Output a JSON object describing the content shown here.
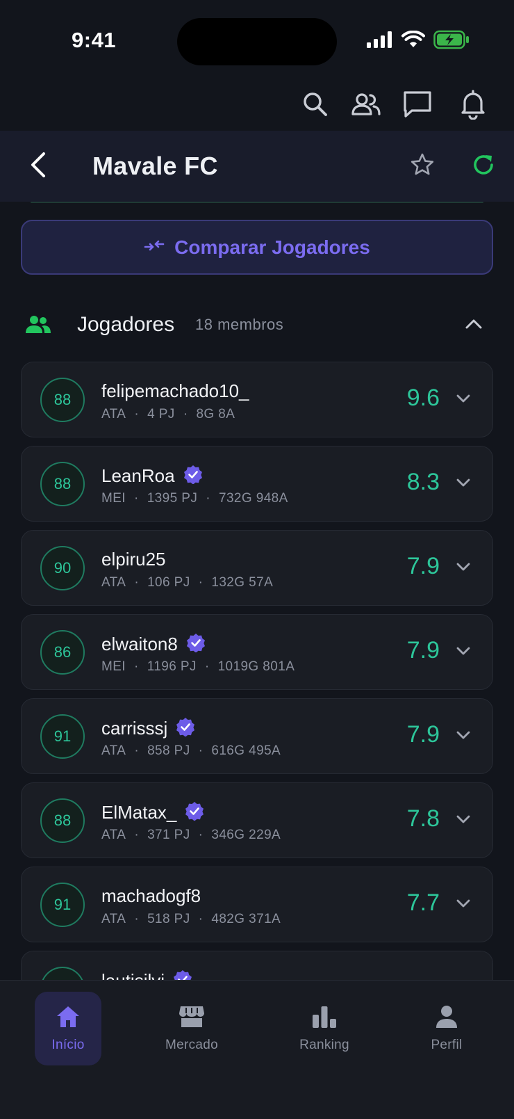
{
  "status_bar": {
    "time": "9:41"
  },
  "header": {
    "title": "Mavale FC"
  },
  "compare_button": {
    "label": "Comparar Jogadores"
  },
  "section": {
    "title": "Jogadores",
    "count": "18 membros"
  },
  "players": [
    {
      "ovr": "88",
      "name": "felipemachado10_",
      "verified": false,
      "position": "ATA",
      "games": "4 PJ",
      "goals_assists": "8G 8A",
      "rating": "9.6"
    },
    {
      "ovr": "88",
      "name": "LeanRoa",
      "verified": true,
      "position": "MEI",
      "games": "1395 PJ",
      "goals_assists": "732G 948A",
      "rating": "8.3"
    },
    {
      "ovr": "90",
      "name": "elpiru25",
      "verified": false,
      "position": "ATA",
      "games": "106 PJ",
      "goals_assists": "132G 57A",
      "rating": "7.9"
    },
    {
      "ovr": "86",
      "name": "elwaiton8",
      "verified": true,
      "position": "MEI",
      "games": "1196 PJ",
      "goals_assists": "1019G 801A",
      "rating": "7.9"
    },
    {
      "ovr": "91",
      "name": "carrisssj",
      "verified": true,
      "position": "ATA",
      "games": "858 PJ",
      "goals_assists": "616G 495A",
      "rating": "7.9"
    },
    {
      "ovr": "88",
      "name": "ElMatax_",
      "verified": true,
      "position": "ATA",
      "games": "371 PJ",
      "goals_assists": "346G 229A",
      "rating": "7.8"
    },
    {
      "ovr": "91",
      "name": "machadogf8",
      "verified": false,
      "position": "ATA",
      "games": "518 PJ",
      "goals_assists": "482G 371A",
      "rating": "7.7"
    },
    {
      "ovr": "",
      "name": "lautisilvi",
      "verified": true,
      "position": "",
      "games": "",
      "goals_assists": "",
      "rating": ""
    }
  ],
  "nav": [
    {
      "label": "Início",
      "icon": "home-icon",
      "active": true
    },
    {
      "label": "Mercado",
      "icon": "store-icon",
      "active": false
    },
    {
      "label": "Ranking",
      "icon": "bar-chart-icon",
      "active": false
    },
    {
      "label": "Perfil",
      "icon": "user-icon",
      "active": false
    }
  ],
  "colors": {
    "accent": "#7b6cf0",
    "rating_green": "#2dc69a",
    "refresh_green": "#22c55e",
    "background": "#12151c"
  }
}
